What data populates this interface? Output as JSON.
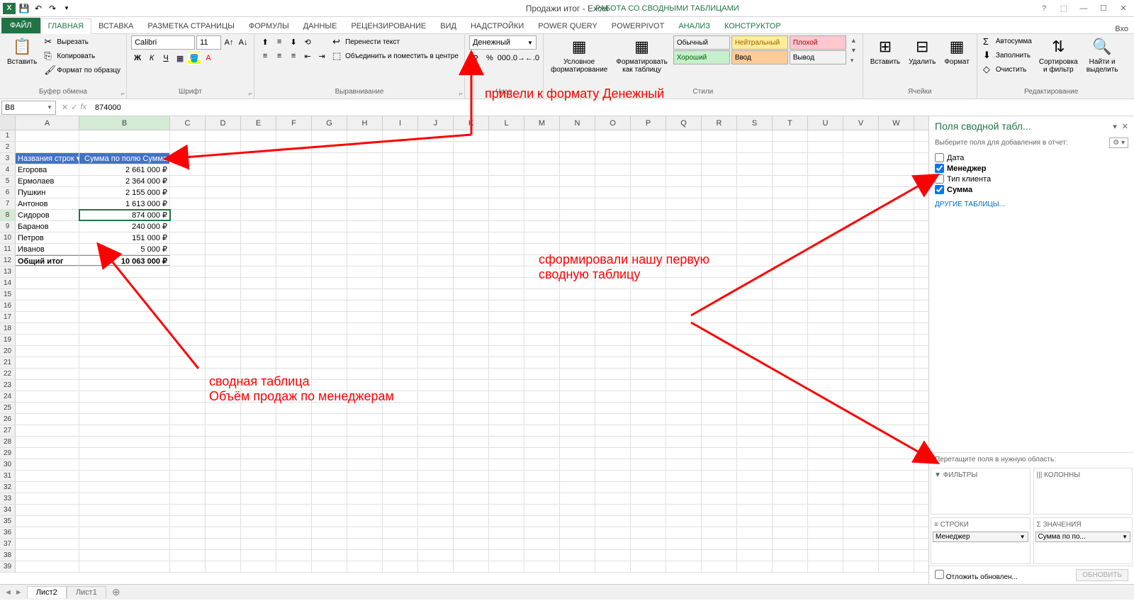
{
  "title": "Продажи итог - Excel",
  "context_tools": "РАБОТА СО СВОДНЫМИ ТАБЛИЦАМИ",
  "login_hint": "Вхо",
  "tabs": {
    "file": "ФАЙЛ",
    "list": [
      "ГЛАВНАЯ",
      "ВСТАВКА",
      "РАЗМЕТКА СТРАНИЦЫ",
      "ФОРМУЛЫ",
      "ДАННЫЕ",
      "РЕЦЕНЗИРОВАНИЕ",
      "ВИД",
      "НАДСТРОЙКИ",
      "POWER QUERY",
      "POWERPIVOT"
    ],
    "ctx": [
      "АНАЛИЗ",
      "КОНСТРУКТОР"
    ]
  },
  "ribbon": {
    "clipboard": {
      "paste": "Вставить",
      "cut": "Вырезать",
      "copy": "Копировать",
      "fmt": "Формат по образцу",
      "label": "Буфер обмена"
    },
    "font": {
      "name": "Calibri",
      "size": "11",
      "label": "Шрифт"
    },
    "align": {
      "wrap": "Перенести текст",
      "merge": "Объединить и поместить в центре",
      "label": "Выравнивание"
    },
    "number": {
      "fmt": "Денежный",
      "label": "Числ"
    },
    "styles": {
      "cond": "Условное\nформатирование",
      "table": "Форматировать\nкак таблицу",
      "normal": "Обычный",
      "neutral": "Нейтральный",
      "bad": "Плохой",
      "good": "Хороший",
      "input": "Ввод",
      "output": "Вывод",
      "label": "Стили"
    },
    "cells": {
      "insert": "Вставить",
      "delete": "Удалить",
      "format": "Формат",
      "label": "Ячейки"
    },
    "editing": {
      "sum": "Автосумма",
      "fill": "Заполнить",
      "clear": "Очистить",
      "sort": "Сортировка\nи фильтр",
      "find": "Найти и\nвыделить",
      "label": "Редактирование"
    }
  },
  "name_box": "B8",
  "formula": "874000",
  "columns": [
    "A",
    "B",
    "C",
    "D",
    "E",
    "F",
    "G",
    "H",
    "I",
    "J",
    "K",
    "L",
    "M",
    "N",
    "O",
    "P",
    "Q",
    "R",
    "S",
    "T",
    "U",
    "V",
    "W"
  ],
  "pivot_header": {
    "rows": "Названия строк",
    "sum": "Сумма по полю Сумма"
  },
  "pivot_rows": [
    {
      "name": "Егорова",
      "val": "2 661 000 ₽"
    },
    {
      "name": "Ермолаев",
      "val": "2 364 000 ₽"
    },
    {
      "name": "Пушкин",
      "val": "2 155 000 ₽"
    },
    {
      "name": "Антонов",
      "val": "1 613 000 ₽"
    },
    {
      "name": "Сидоров",
      "val": "874 000 ₽"
    },
    {
      "name": "Баранов",
      "val": "240 000 ₽"
    },
    {
      "name": "Петров",
      "val": "151 000 ₽"
    },
    {
      "name": "Иванов",
      "val": "5 000 ₽"
    }
  ],
  "pivot_total": {
    "label": "Общий итог",
    "val": "10 063 000 ₽"
  },
  "pivot_pane": {
    "title": "Поля сводной табл...",
    "sub": "Выберите поля для добавления в отчет:",
    "fields": [
      {
        "label": "Дата",
        "checked": false
      },
      {
        "label": "Менеджер",
        "checked": true
      },
      {
        "label": "Тип клиента",
        "checked": false
      },
      {
        "label": "Сумма",
        "checked": true
      }
    ],
    "other": "ДРУГИЕ ТАБЛИЦЫ...",
    "drag": "Перетащите поля в нужную область:",
    "filters": "ФИЛЬТРЫ",
    "cols": "КОЛОННЫ",
    "rows": "СТРОКИ",
    "vals": "ЗНАЧЕНИЯ",
    "row_item": "Менеджер",
    "val_item": "Сумма по по...",
    "defer": "Отложить обновлен...",
    "update": "ОБНОВИТЬ"
  },
  "sheets": {
    "active": "Лист2",
    "other": "Лист1"
  },
  "annotations": {
    "a1": "привели к формату Денежный",
    "a2": "сформировали нашу первую\nсводную таблицу",
    "a3": "сводная таблица\nОбъём продаж по менеджерам"
  }
}
